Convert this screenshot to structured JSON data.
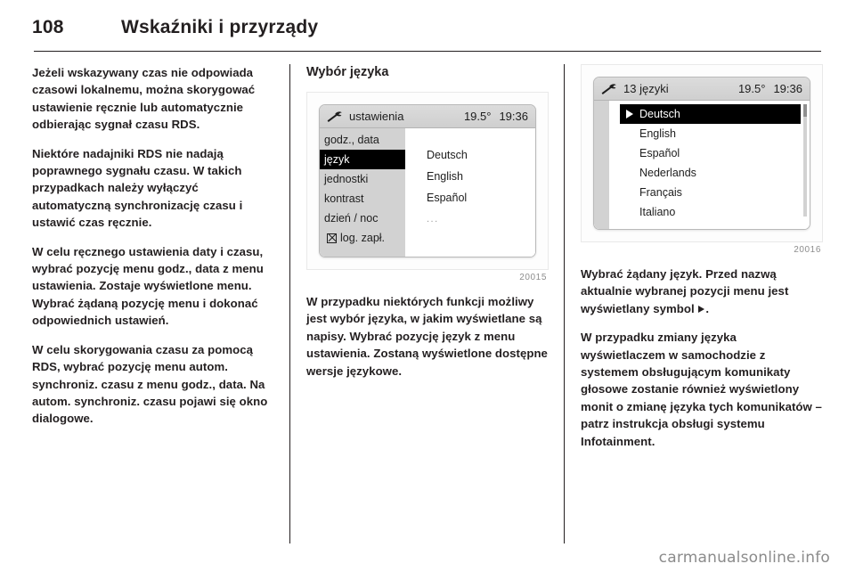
{
  "header": {
    "page_number": "108",
    "chapter_title": "Wskaźniki i przyrządy"
  },
  "left_column": {
    "paragraphs": [
      "Jeżeli wskazywany czas nie odpowiada czasowi lokalnemu, można skorygować ustawienie ręcznie lub automatycznie odbierając sygnał czasu RDS.",
      "Niektóre nadajniki RDS nie nadają poprawnego sygnału czasu. W takich przypadkach należy wyłączyć automatyczną synchronizację czasu i ustawić czas ręcznie.",
      "W celu ręcznego ustawienia daty i czasu, wybrać pozycję menu godz., data z menu ustawienia. Zostaje wyświetlone menu. Wybrać żądaną pozycję menu i dokonać odpowiednich ustawień.",
      "W celu skorygowania czasu za pomocą RDS, wybrać pozycję menu autom. synchroniz. czasu z menu godz., data. Na autom. synchroniz. czasu pojawi się okno dialogowe."
    ]
  },
  "middle_column": {
    "subhead": "Wybór języka",
    "figure": {
      "caption": "20015",
      "display": {
        "status": {
          "icon": "settings-wrench-icon",
          "title": "ustawienia",
          "temperature": "19.5°",
          "time": "19:36"
        },
        "menu_items": [
          {
            "label": "godz., data",
            "selected": false,
            "icon": null
          },
          {
            "label": "język",
            "selected": true,
            "icon": null
          },
          {
            "label": "jednostki",
            "selected": false,
            "icon": null
          },
          {
            "label": "kontrast",
            "selected": false,
            "icon": null
          },
          {
            "label": "dzień / noc",
            "selected": false,
            "icon": null
          },
          {
            "label": "log. zapł.",
            "selected": false,
            "icon": "ignition-checkbox-icon"
          }
        ],
        "values": [
          {
            "label": "Deutsch",
            "muted": false
          },
          {
            "label": "English",
            "muted": false
          },
          {
            "label": "Español",
            "muted": false
          },
          {
            "label": "...",
            "muted": true
          }
        ]
      }
    },
    "paragraphs": [
      "W przypadku niektórych funkcji możliwy jest wybór języka, w jakim wyświetlane są napisy. Wybrać pozycję język z menu ustawienia. Zostaną wyświetlone dostępne wersje językowe."
    ]
  },
  "right_column": {
    "figure": {
      "caption": "20016",
      "display": {
        "status": {
          "icon": "settings-wrench-icon",
          "title": "13 języki",
          "temperature": "19.5°",
          "time": "19:36"
        },
        "languages": [
          {
            "label": "Deutsch",
            "selected": true
          },
          {
            "label": "English",
            "selected": false
          },
          {
            "label": "Español",
            "selected": false
          },
          {
            "label": "Nederlands",
            "selected": false
          },
          {
            "label": "Français",
            "selected": false
          },
          {
            "label": "Italiano",
            "selected": false
          }
        ]
      }
    },
    "paragraph_1_before_glyph": "Wybrać żądany język. Przed nazwą aktualnie wybranej pozycji menu jest wyświetlany symbol ",
    "paragraph_1_after_glyph": ".",
    "paragraphs": [
      "W przypadku zmiany języka wyświetlaczem w samochodzie z systemem obsługującym komunikaty głosowe zostanie również wyświetlony monit o zmianę języka tych komunikatów – patrz instrukcja obsługi systemu Infotainment."
    ]
  },
  "footer": {
    "watermark": "carmanualsonline.info"
  },
  "colors": {
    "ink": "#231f20",
    "display_menu_bg": "#d2d2d2",
    "display_selected_bg": "#000000",
    "watermark": "#8b8b8b"
  }
}
